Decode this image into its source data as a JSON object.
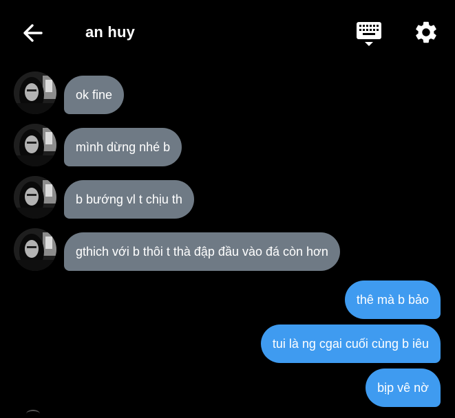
{
  "header": {
    "contact_name": "an huy",
    "back_icon": "arrow-left-icon",
    "keyboard_icon": "keyboard-icon",
    "settings_icon": "gear-icon"
  },
  "messages": [
    {
      "direction": "incoming",
      "text": "ok fine"
    },
    {
      "direction": "incoming",
      "text": "mình dừng nhé b"
    },
    {
      "direction": "incoming",
      "text": "b bướng vl t chịu th"
    },
    {
      "direction": "incoming",
      "text": "gthich với b thôi t thà đập đầu vào đá còn hơn"
    },
    {
      "direction": "outgoing",
      "text": "thê mà b bảo"
    },
    {
      "direction": "outgoing",
      "text": "tui là ng cgai cuối cùng b iêu"
    },
    {
      "direction": "outgoing",
      "text": "bịp vê nờ"
    }
  ],
  "colors": {
    "background": "#000000",
    "incoming_bubble": "#6f7a85",
    "outgoing_bubble": "#3f9bf0",
    "text": "#ffffff"
  }
}
